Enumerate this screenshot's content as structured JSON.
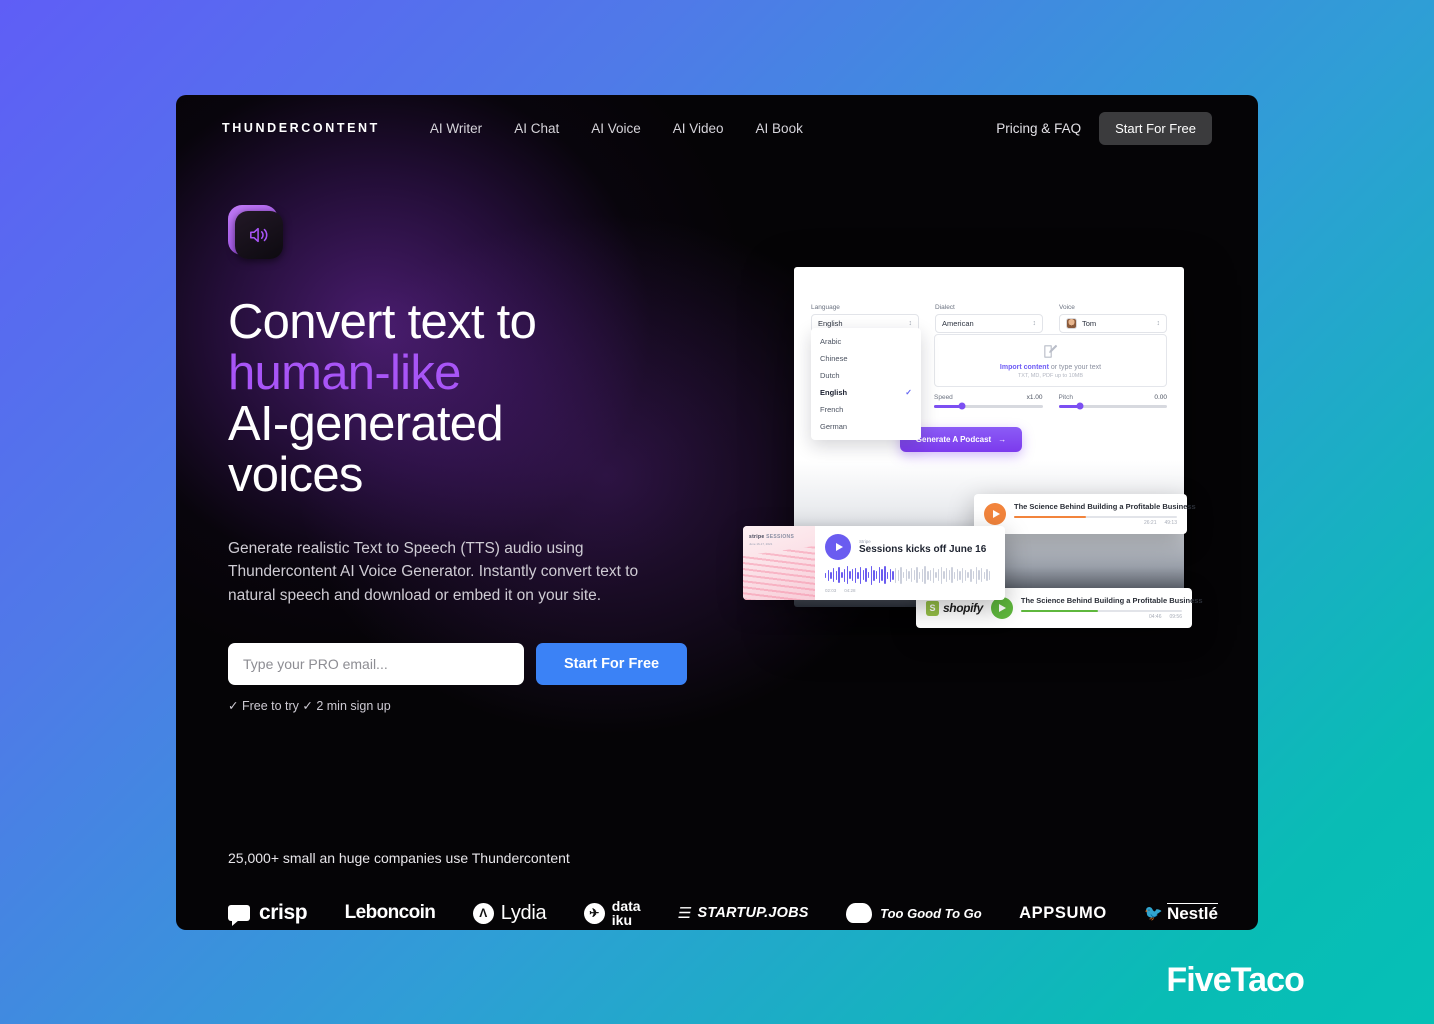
{
  "nav": {
    "brand": "THUNDERCONTENT",
    "links": [
      {
        "label": "AI Writer"
      },
      {
        "label": "AI Chat"
      },
      {
        "label": "AI Voice"
      },
      {
        "label": "AI Video"
      },
      {
        "label": "AI Book"
      }
    ],
    "pricing_label": "Pricing & FAQ",
    "cta_label": "Start For Free"
  },
  "hero": {
    "icon": "speaker-volume-icon",
    "title_line1": "Convert text to",
    "title_accent": "human-like",
    "title_line3": "AI-generated",
    "title_line4": "voices",
    "subtitle": "Generate realistic Text to Speech (TTS) audio using Thundercontent AI Voice Generator. Instantly convert text to natural speech and download or embed it on your site.",
    "email_placeholder": "Type your PRO email...",
    "email_value": "",
    "cta_label": "Start For Free",
    "note": "✓ Free to try ✓ 2 min sign up",
    "accent_color": "#a855f7",
    "cta_color": "#3b82f6"
  },
  "mockup": {
    "fields": [
      {
        "label": "Language",
        "value": "English"
      },
      {
        "label": "Dialect",
        "value": "American"
      },
      {
        "label": "Voice",
        "value": "Tom"
      }
    ],
    "language_options": [
      {
        "label": "Arabic",
        "selected": false
      },
      {
        "label": "Chinese",
        "selected": false
      },
      {
        "label": "Dutch",
        "selected": false
      },
      {
        "label": "English",
        "selected": true
      },
      {
        "label": "French",
        "selected": false
      },
      {
        "label": "German",
        "selected": false
      }
    ],
    "import": {
      "link_label": "Import content",
      "rest_label": " or type your text",
      "hint": "TXT, MD, PDF up to 10MB"
    },
    "sliders": [
      {
        "label": "Speed",
        "value": "x1.00",
        "fill_pct": 26
      },
      {
        "label": "Pitch",
        "value": "0.00",
        "fill_pct": 20
      }
    ],
    "generate_label": "Generate A Podcast",
    "generate_arrow": "→",
    "generate_color": "#7c3aed",
    "cards": [
      {
        "id": "orange",
        "title": "The Science Behind Building a Profitable Business",
        "current_time": "26:21",
        "total_time": "49:13",
        "progress_pct": 44,
        "color": "#f2843c"
      },
      {
        "id": "shopify",
        "brand": "shopify",
        "title": "The Science Behind Building a Profitable Business",
        "current_time": "04:46",
        "total_time": "09:56",
        "progress_pct": 48,
        "color": "#5fb83d"
      },
      {
        "id": "stripe",
        "brand_art_label": "stripe",
        "brand_art_label2": "SESSIONS",
        "brand_art_sub": "June 16-17, 2021",
        "kicker": "Stripe",
        "title": "Sessions kicks off June 16",
        "current_time": "02:03",
        "total_time": "04:28",
        "progress_pct": 42,
        "color": "#6a5cf0"
      }
    ]
  },
  "social_proof": {
    "caption": "25,000+ small an huge companies use Thundercontent",
    "logos": [
      {
        "name": "crisp",
        "label": "crisp"
      },
      {
        "name": "leboncoin",
        "label": "Leboncoin"
      },
      {
        "name": "lydia",
        "label": "Lydia",
        "mark": "Λ"
      },
      {
        "name": "dataiku",
        "label_line1": "data",
        "label_line2": "iku"
      },
      {
        "name": "startup-jobs",
        "label": "STARTUP.JOBS"
      },
      {
        "name": "too-good-to-go",
        "label": "Too Good To Go"
      },
      {
        "name": "appsumo",
        "label": "APPSUMO"
      },
      {
        "name": "nestle",
        "label": "Nestlé"
      }
    ]
  },
  "watermark": {
    "label": "FiveTaco"
  }
}
